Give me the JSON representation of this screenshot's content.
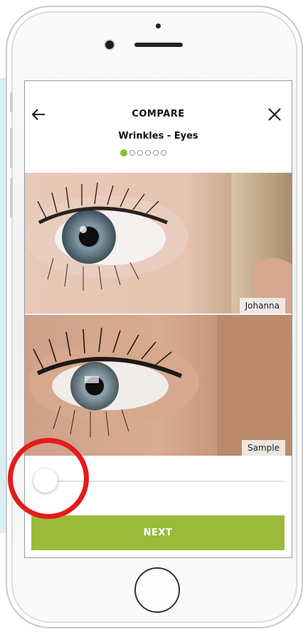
{
  "header": {
    "title": "COMPARE",
    "subtitle": "Wrinkles - Eyes",
    "back_icon": "arrow-left-icon",
    "close_icon": "close-icon"
  },
  "progress": {
    "total_steps": 6,
    "current_step": 1
  },
  "photos": [
    {
      "label": "Johanna"
    },
    {
      "label": "Sample"
    }
  ],
  "slider": {
    "value": 0
  },
  "footer": {
    "next_label": "NEXT"
  },
  "colors": {
    "accent": "#9bbb3b",
    "highlight": "#e31b1b"
  }
}
